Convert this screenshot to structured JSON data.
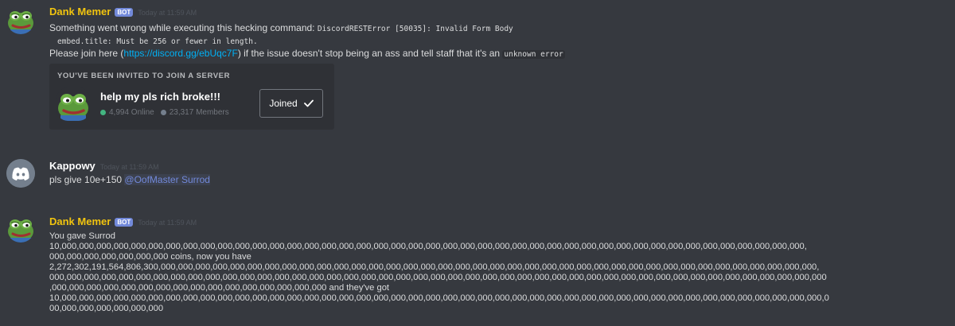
{
  "colors": {
    "background": "#36393f",
    "bot_name": "#f1c40f",
    "user_name": "#ffffff",
    "bot_tag": "#7289da",
    "link": "#00b0f4",
    "mention": "#7289da",
    "online_dot": "#43b581",
    "member_dot": "#747f8d"
  },
  "messages": [
    {
      "author": "Dank Memer",
      "bot_tag": "BOT",
      "timestamp": "Today at 11:59 AM",
      "avatar_icon": "pepe-frog-avatar",
      "line1_text": "Something went wrong while executing this hecking command: ",
      "line1_code": "DiscordRESTError [50035]: Invalid Form Body",
      "line2_code": "embed.title: Must be 256 or fewer in length.",
      "line3_pre": "Please join here (",
      "line3_link": "https://discord.gg/ebUqc7F",
      "line3_mid": ") if the issue doesn't stop being an ass and tell staff that it's an ",
      "line3_code": "unknown error",
      "invite": {
        "title": "YOU'VE BEEN INVITED TO JOIN A SERVER",
        "server_name": "help my pls rich broke!!!",
        "online": "4,994 Online",
        "members": "23,317 Members",
        "button_label": "Joined",
        "server_icon": "pepe-frog-server-icon",
        "button_icon": "checkmark-icon"
      }
    },
    {
      "author": "Kappowy",
      "timestamp": "Today at 11:59 AM",
      "avatar_icon": "discord-logo-avatar",
      "text": "pls give 10e+150 ",
      "mention": "@OofMaster Surrod"
    },
    {
      "author": "Dank Memer",
      "bot_tag": "BOT",
      "timestamp": "Today at 11:59 AM",
      "avatar_icon": "pepe-frog-avatar",
      "line1": "You gave Surrod",
      "line2": "10,000,000,000,000,000,000,000,000,000,000,000,000,000,000,000,000,000,000,000,000,000,000,000,000,000,000,000,000,000,000,000,000,000,000,000,000,000,000,000,000,000,000,000,",
      "line3": "000,000,000,000,000,000,000 coins, now you have",
      "line4": "2,272,302,191,564,806,300,000,000,000,000,000,000,000,000,000,000,000,000,000,000,000,000,000,000,000,000,000,000,000,000,000,000,000,000,000,000,000,000,000,000,000,000,000,000,",
      "line5": "000,000,000,000,000,000,000,000,000,000,000,000,000,000,000,000,000,000,000,000,000,000,000,000,000,000,000,000,000,000,000,000,000,000,000,000,000,000,000,000,000,000,000,000,000",
      "line6": ",000,000,000,000,000,000,000,000,000,000,000,000,000,000,000,000 and they've got",
      "line7": "10,000,000,000,000,000,000,000,000,000,000,000,000,000,000,000,000,000,000,000,000,000,000,000,000,000,000,000,000,000,000,000,000,000,000,000,000,000,000,000,000,000,000,000,000,0",
      "line8": "00,000,000,000,000,000,000"
    }
  ]
}
